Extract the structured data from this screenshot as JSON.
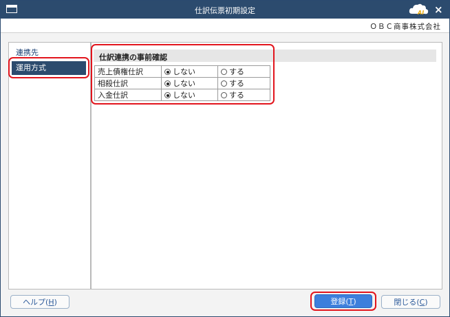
{
  "window": {
    "title": "仕訳伝票初期設定",
    "close_glyph": "×",
    "logo_text": "AI"
  },
  "company": "ＯＢＣ商事株式会社",
  "sidebar": {
    "items": [
      {
        "label": "連携先"
      },
      {
        "label": "運用方式"
      }
    ]
  },
  "section": {
    "title": "仕訳連携の事前確認",
    "rows": [
      {
        "label": "売上債権仕訳",
        "opt1": "しない",
        "opt2": "する",
        "selected": "しない"
      },
      {
        "label": "相殺仕訳",
        "opt1": "しない",
        "opt2": "する",
        "selected": "しない"
      },
      {
        "label": "入金仕訳",
        "opt1": "しない",
        "opt2": "する",
        "selected": "しない"
      }
    ]
  },
  "buttons": {
    "help": {
      "label": "ヘルプ(",
      "key": "H",
      "suffix": ")"
    },
    "register": {
      "label": "登録(",
      "key": "T",
      "suffix": ")"
    },
    "close": {
      "label": "閉じる(",
      "key": "C",
      "suffix": ")"
    }
  },
  "colors": {
    "titlebar": "#2c4b6e",
    "accent": "#3d7fdc",
    "highlight": "#e2141c",
    "sidebar_active": "#2c4b6e"
  }
}
